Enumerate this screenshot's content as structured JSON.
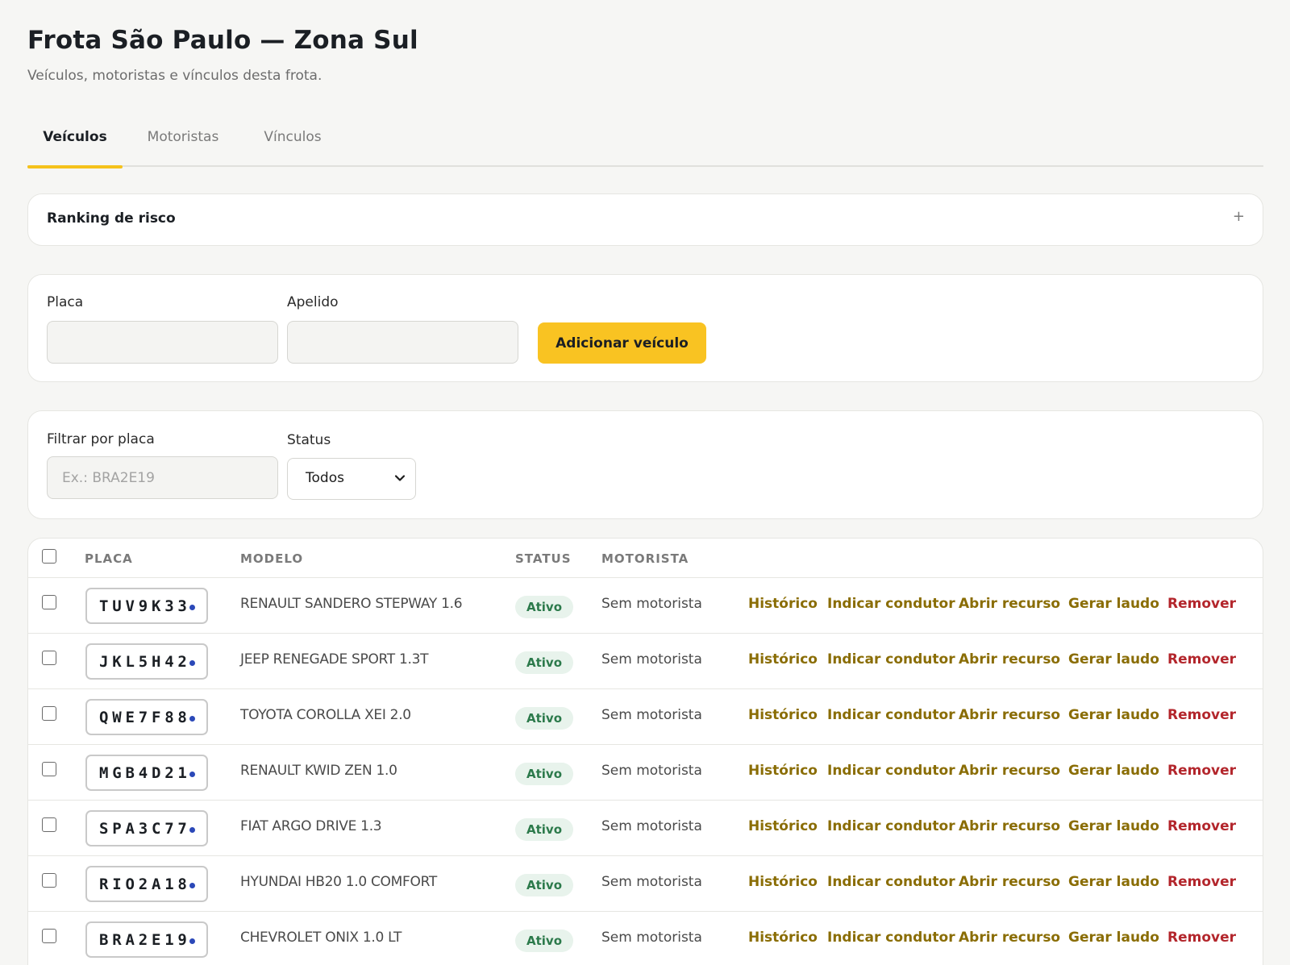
{
  "page": {
    "title": "Frota São Paulo — Zona Sul",
    "subtitle": "Veículos, motoristas e vínculos desta frota."
  },
  "tabs": [
    {
      "label": "Veículos",
      "active": true
    },
    {
      "label": "Motoristas",
      "active": false
    },
    {
      "label": "Vínculos",
      "active": false
    }
  ],
  "ranking": {
    "title": "Ranking de risco",
    "toggle": "+"
  },
  "add_form": {
    "plate_label": "Placa",
    "plate_value": "",
    "nickname_label": "Apelido",
    "nickname_value": "",
    "submit_label": "Adicionar veículo"
  },
  "filters": {
    "plate_label": "Filtrar por placa",
    "plate_placeholder": "Ex.: BRA2E19",
    "status_label": "Status",
    "status_value": "Todos"
  },
  "table": {
    "headers": {
      "plate": "PLACA",
      "model": "MODELO",
      "status": "STATUS",
      "driver": "MOTORISTA"
    },
    "actions": {
      "history": "Histórico",
      "indicate": "Indicar condutor",
      "appeal": "Abrir recurso",
      "report": "Gerar laudo",
      "remove": "Remover"
    },
    "rows": [
      {
        "plate": "TUV9K33",
        "model": "RENAULT SANDERO STEPWAY 1.6",
        "status": "Ativo",
        "driver": "Sem motorista"
      },
      {
        "plate": "JKL5H42",
        "model": "JEEP RENEGADE SPORT 1.3T",
        "status": "Ativo",
        "driver": "Sem motorista"
      },
      {
        "plate": "QWE7F88",
        "model": "TOYOTA COROLLA XEI 2.0",
        "status": "Ativo",
        "driver": "Sem motorista"
      },
      {
        "plate": "MGB4D21",
        "model": "RENAULT KWID ZEN 1.0",
        "status": "Ativo",
        "driver": "Sem motorista"
      },
      {
        "plate": "SPA3C77",
        "model": "FIAT ARGO DRIVE 1.3",
        "status": "Ativo",
        "driver": "Sem motorista"
      },
      {
        "plate": "RIO2A18",
        "model": "HYUNDAI HB20 1.0 COMFORT",
        "status": "Ativo",
        "driver": "Sem motorista"
      },
      {
        "plate": "BRA2E19",
        "model": "CHEVROLET ONIX 1.0 LT",
        "status": "Ativo",
        "driver": "Sem motorista"
      }
    ]
  },
  "colors": {
    "accent": "#f9c322",
    "action": "#8a6d05",
    "danger": "#b3262c",
    "status_bg": "#e8f3ec",
    "status_text": "#2c7a4b",
    "plate_dot": "#2b48b8"
  },
  "icons": {
    "select": "chevron-down-icon",
    "ranking_toggle": "plus-icon",
    "plate": "plate-dot-icon"
  }
}
